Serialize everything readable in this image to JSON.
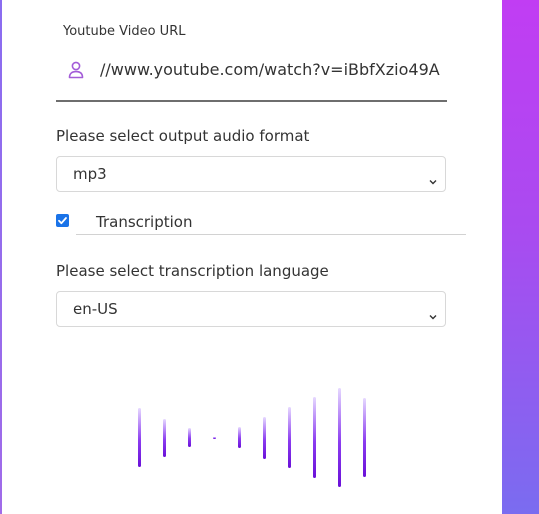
{
  "form": {
    "url_label": "Youtube Video URL",
    "url_value": "//www.youtube.com/watch?v=iBbfXzio49A",
    "format_label": "Please select output audio format",
    "format_selected": "mp3",
    "transcription_label": "Transcription",
    "transcription_checked": true,
    "language_label": "Please select transcription language",
    "language_selected": "en-US"
  },
  "icons": {
    "url_field": "user-icon",
    "select_arrow": "chevron-down-icon",
    "checkbox": "check-icon"
  },
  "colors": {
    "accent": "#1a73e8",
    "icon_purple": "#a35cd8",
    "side_gradient_top": "#c13df3",
    "side_gradient_bottom": "#7a6cf0",
    "wave_bar": "#7a1de0"
  }
}
